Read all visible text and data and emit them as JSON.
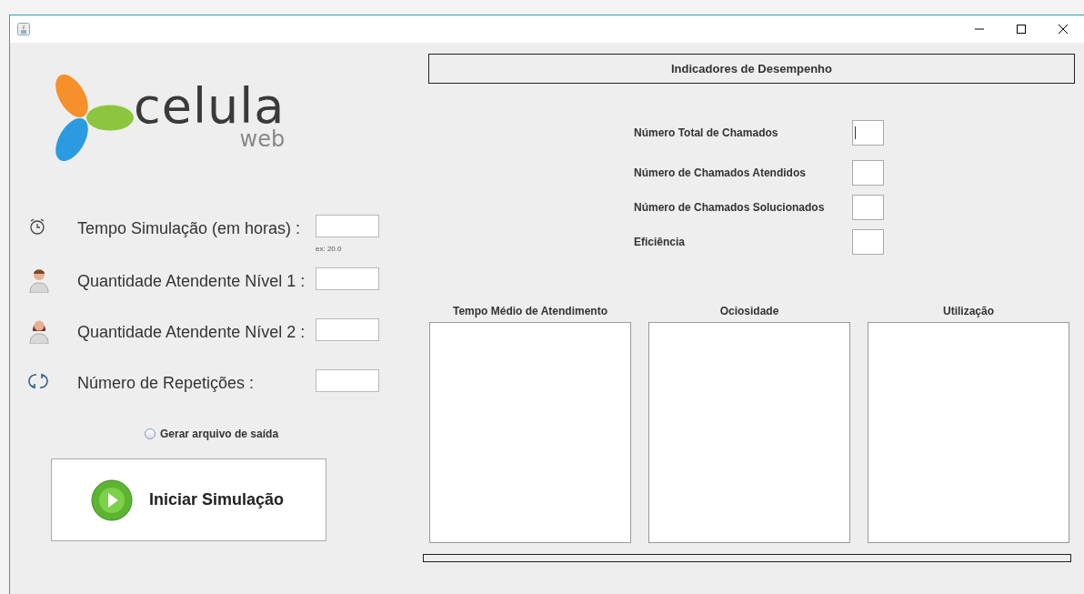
{
  "logo": {
    "name": "celula",
    "subtitle": "web"
  },
  "form": {
    "rows": [
      {
        "kind": "clock",
        "label": "Tempo Simulação (em horas) :",
        "hint": "ex: 20.0"
      },
      {
        "kind": "agent-male",
        "label": "Quantidade Atendente Nível 1 :"
      },
      {
        "kind": "agent-female",
        "label": "Quantidade Atendente Nível 2 :"
      },
      {
        "kind": "repeat",
        "label": "Número de Repetições :"
      }
    ],
    "output_file": {
      "label": "Gerar arquivo de saída",
      "selected": false
    },
    "start_button": "Iniciar Simulação"
  },
  "indicators": {
    "title": "Indicadores de Desempenho",
    "items": [
      {
        "label": "Número Total de Chamados",
        "focused": true
      },
      {
        "label": "Número de Chamados Atendidos",
        "focused": false
      },
      {
        "label": "Número de Chamados Solucionados",
        "focused": false
      },
      {
        "label": "Eficiência",
        "focused": false
      }
    ]
  },
  "panels": [
    {
      "title": "Tempo Médio de Atendimento"
    },
    {
      "title": "Ociosidade"
    },
    {
      "title": "Utilização"
    }
  ],
  "progress": {
    "level": 0
  }
}
